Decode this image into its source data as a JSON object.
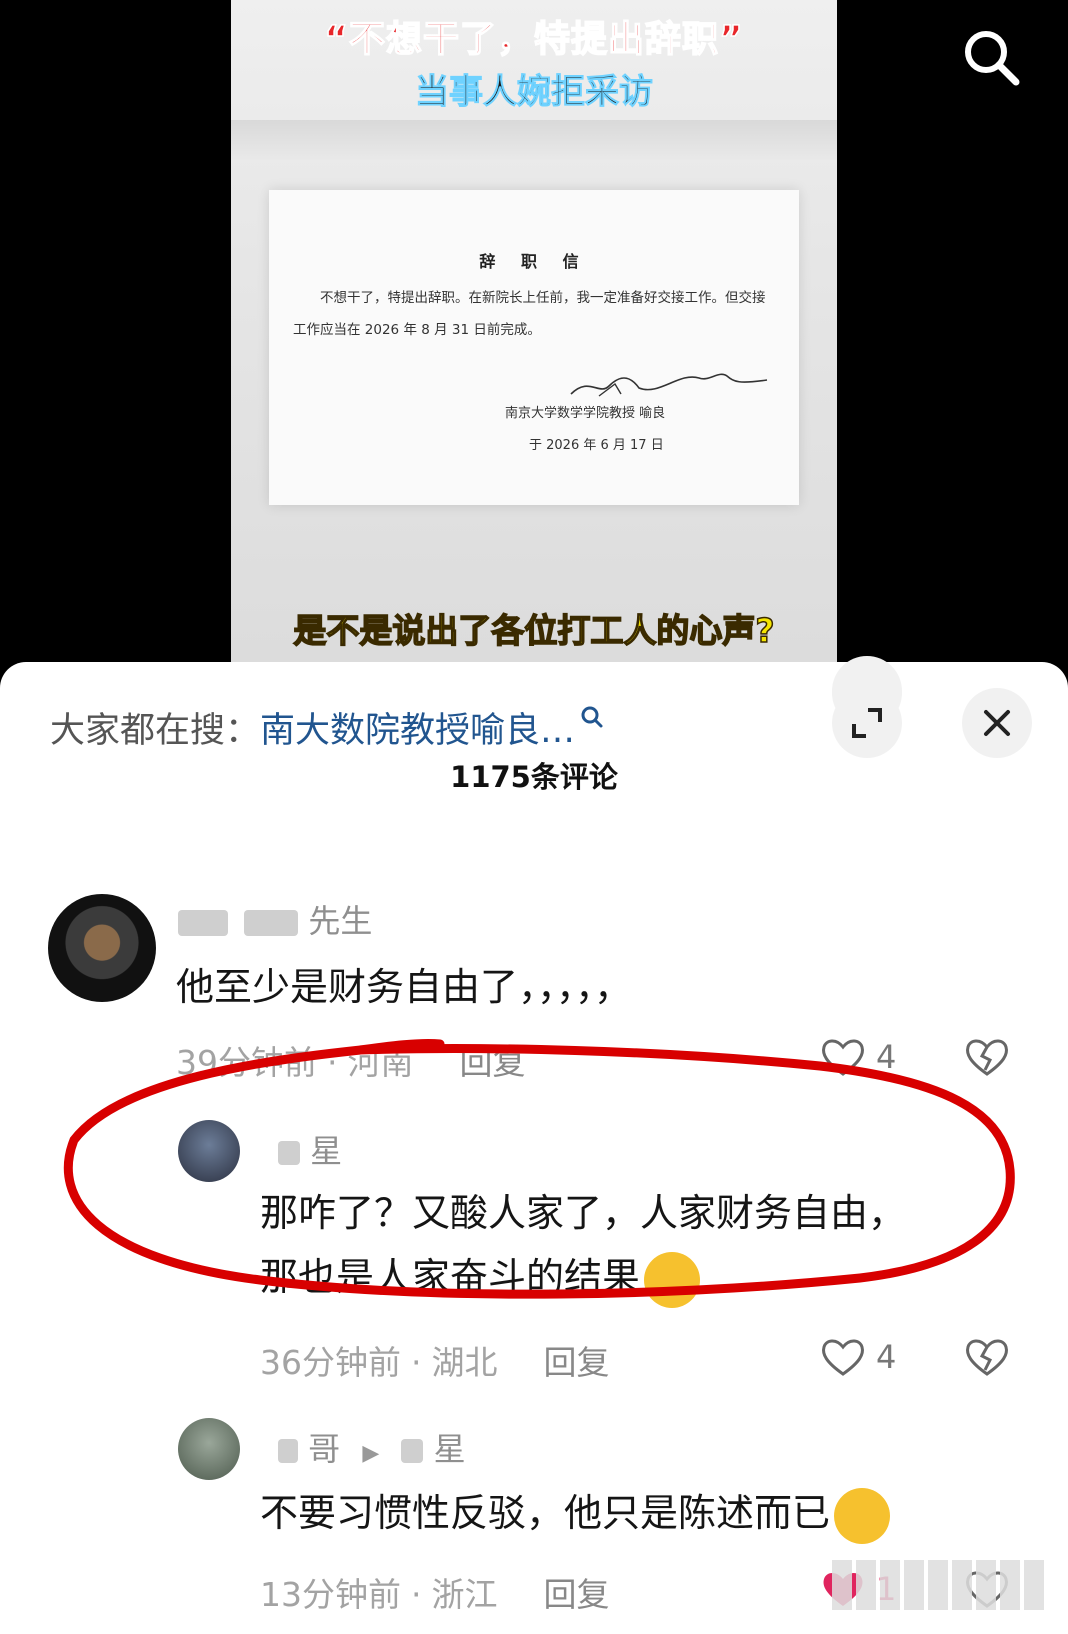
{
  "video": {
    "title_line1": "“不想干了，特提出辞职”",
    "title_line2": "当事人婉拒采访",
    "letter_title": "辞 职 信",
    "letter_body": "不想干了，特提出辞职。在新院长上任前，我一定准备好交接工作。但交接工作应当在 2026 年 8 月 31 日前完成。",
    "letter_signer": "南京大学数学学院教授 喻良",
    "letter_date": "于 2026 年 6 月 17 日",
    "caption": "是不是说出了各位打工人的心声?"
  },
  "search_icon": "search-icon",
  "hot_search": {
    "label": "大家都在搜：",
    "query": "南大数院教授喻良…",
    "icon": "search-icon"
  },
  "buttons": {
    "expand_icon": "expand-icon",
    "close_icon": "close-icon"
  },
  "comment_count": "1175条评论",
  "comments": [
    {
      "name": "先生",
      "text": "他至少是财务自由了，，，，，",
      "time": "39分钟前",
      "region": "河南",
      "reply": "回复",
      "likes": "4"
    },
    {
      "name": "星",
      "text_line1": "那咋了？又酸人家了，人家财务自由，",
      "text_line2": "那也是人家奋斗的结果",
      "time": "36分钟前",
      "region": "湖北",
      "reply": "回复",
      "likes": "4"
    },
    {
      "name": "哥",
      "reply_to": "星",
      "text": "不要习惯性反驳，他只是陈述而已",
      "time": "13分钟前",
      "region": "浙江",
      "reply": "回复",
      "likes": "1"
    }
  ],
  "colors": {
    "link": "#21558f",
    "annotation": "#d80000",
    "liked": "#e0245e"
  }
}
